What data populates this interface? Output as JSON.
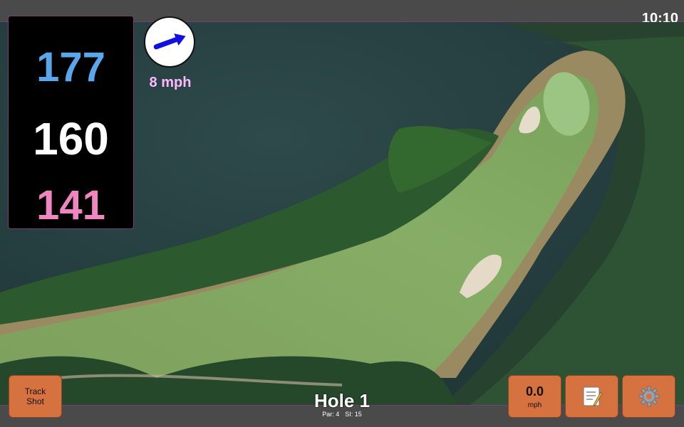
{
  "status": {
    "time": "10:10"
  },
  "distances": {
    "back": "177",
    "center": "160",
    "front": "141",
    "colors": {
      "back": "#5aa6ea",
      "center": "#ffffff",
      "front": "#ef86bf"
    }
  },
  "wind": {
    "speed": "8 mph",
    "color": "#ffb8ff",
    "arrow_icon": "wind-direction-arrow"
  },
  "buttons": {
    "track_shot": {
      "line1": "Track",
      "line2": "Shot"
    },
    "speed": {
      "value": "0.0",
      "unit": "mph"
    },
    "notes_icon": "notepad-icon",
    "settings_icon": "gear-icon"
  },
  "hole": {
    "title": "Hole 1",
    "par": "Par: 4",
    "si": "SI: 15"
  },
  "theme": {
    "button": "#d6723f",
    "accent_border": "#7a3b78",
    "bar": "#4a4a4a"
  }
}
